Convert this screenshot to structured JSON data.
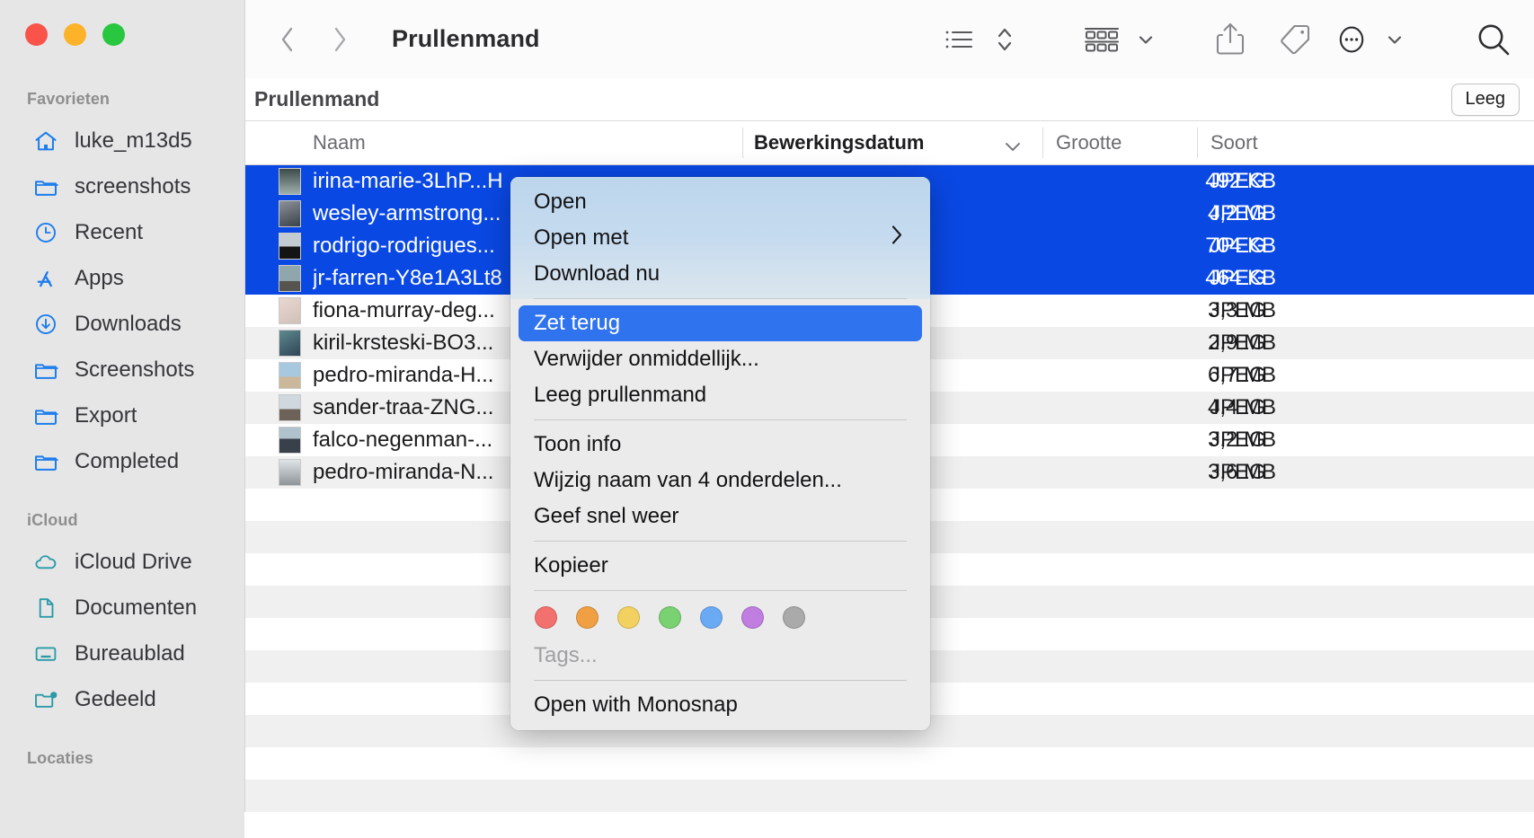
{
  "window": {
    "title": "Prullenmand",
    "traffic_lights": [
      "close-red",
      "minimize-yellow",
      "zoom-green"
    ]
  },
  "toolbar": {
    "back_icon": "chevron-left-icon",
    "forward_icon": "chevron-right-icon",
    "view_list_icon": "list-view-icon",
    "view_sort_icon": "sort-chevrons-icon",
    "group_icon": "group-by-icon",
    "group_chevron_icon": "chevron-down-icon",
    "share_icon": "share-icon",
    "tag_icon": "tag-icon",
    "more_icon": "ellipsis-circle-icon",
    "more_chevron_icon": "chevron-down-icon",
    "search_icon": "search-icon"
  },
  "pathbar": {
    "label": "Prullenmand",
    "empty_button": "Leeg"
  },
  "columns": {
    "name": "Naam",
    "date_modified": "Bewerkingsdatum",
    "size": "Grootte",
    "kind": "Soort",
    "sort_chevron_icon": "chevron-down-icon"
  },
  "sidebar": {
    "groups": [
      {
        "title": "Favorieten",
        "items": [
          {
            "label": "luke_m13d5",
            "icon": "home-icon",
            "color": "#1c7ced"
          },
          {
            "label": "screenshots",
            "icon": "folder-icon",
            "color": "#1c7ced"
          },
          {
            "label": "Recent",
            "icon": "clock-icon",
            "color": "#1c7ced"
          },
          {
            "label": "Apps",
            "icon": "appstore-icon",
            "color": "#1c7ced"
          },
          {
            "label": "Downloads",
            "icon": "download-circle-icon",
            "color": "#1c7ced"
          },
          {
            "label": "Screenshots",
            "icon": "folder-icon",
            "color": "#1c7ced"
          },
          {
            "label": "Export",
            "icon": "folder-icon",
            "color": "#1c7ced"
          },
          {
            "label": "Completed",
            "icon": "folder-icon",
            "color": "#1c7ced"
          }
        ]
      },
      {
        "title": "iCloud",
        "items": [
          {
            "label": "iCloud Drive",
            "icon": "cloud-icon",
            "color": "#2a9aa8"
          },
          {
            "label": "Documenten",
            "icon": "document-icon",
            "color": "#2a9aa8"
          },
          {
            "label": "Bureaublad",
            "icon": "desktop-icon",
            "color": "#2a9aa8"
          },
          {
            "label": "Gedeeld",
            "icon": "shared-folder-icon",
            "color": "#2a9aa8"
          }
        ]
      },
      {
        "title": "Locaties",
        "items": []
      }
    ]
  },
  "files": [
    {
      "name": "irina-marie-3LhP...H",
      "size": "492 KB",
      "kind": "JPEG",
      "selected": true,
      "thumb": [
        "#3d4a4a",
        "#9fb0ac"
      ]
    },
    {
      "name": "wesley-armstrong...",
      "size": "4,2 MB",
      "kind": "JPEG",
      "selected": true,
      "thumb": [
        "#8d9299",
        "#39414a"
      ]
    },
    {
      "name": "rodrigo-rodrigues...",
      "size": "704 KB",
      "kind": "JPEG",
      "selected": true,
      "thumb": [
        "#c3cbd2",
        "#141414"
      ]
    },
    {
      "name": "jr-farren-Y8e1A3Lt8",
      "size": "464 KB",
      "kind": "JPEG",
      "selected": true,
      "thumb": [
        "#8fa6ad",
        "#55544f"
      ]
    },
    {
      "name": "fiona-murray-deg...",
      "size": "3,3 MB",
      "kind": "JPEG",
      "selected": false,
      "thumb": [
        "#e9d8d1",
        "#cfc0b7"
      ]
    },
    {
      "name": "kiril-krsteski-BO3...",
      "size": "2,9 MB",
      "kind": "JPEG",
      "selected": false,
      "thumb": [
        "#5f8a8f",
        "#2e4455"
      ]
    },
    {
      "name": "pedro-miranda-H...",
      "size": "6,7 MB",
      "kind": "JPEG",
      "selected": false,
      "thumb": [
        "#a8c8e0",
        "#cbb79a"
      ]
    },
    {
      "name": "sander-traa-ZNG...",
      "size": "4,4 MB",
      "kind": "JPEG",
      "selected": false,
      "thumb": [
        "#cfd8df",
        "#6c6257"
      ]
    },
    {
      "name": "falco-negenman-...",
      "size": "3,2 MB",
      "kind": "JPEG",
      "selected": false,
      "thumb": [
        "#b0c2cc",
        "#38404a"
      ]
    },
    {
      "name": "pedro-miranda-N...",
      "size": "3,6 MB",
      "kind": "JPEG",
      "selected": false,
      "thumb": [
        "#dfe4e7",
        "#8f9499"
      ]
    }
  ],
  "context_menu": {
    "groups": [
      {
        "tinted": true,
        "items": [
          {
            "label": "Open",
            "submenu": false,
            "highlight": false
          },
          {
            "label": "Open met",
            "submenu": true,
            "highlight": false
          },
          {
            "label": "Download nu",
            "submenu": false,
            "highlight": false
          }
        ]
      },
      {
        "tinted": false,
        "items": [
          {
            "label": "Zet terug",
            "submenu": false,
            "highlight": true
          },
          {
            "label": "Verwijder onmiddellijk...",
            "submenu": false,
            "highlight": false
          },
          {
            "label": "Leeg prullenmand",
            "submenu": false,
            "highlight": false
          }
        ]
      },
      {
        "tinted": false,
        "items": [
          {
            "label": "Toon info",
            "submenu": false,
            "highlight": false
          },
          {
            "label": "Wijzig naam van 4 onderdelen...",
            "submenu": false,
            "highlight": false
          },
          {
            "label": "Geef snel weer",
            "submenu": false,
            "highlight": false
          }
        ]
      },
      {
        "tinted": false,
        "items": [
          {
            "label": "Kopieer",
            "submenu": false,
            "highlight": false
          }
        ]
      }
    ],
    "tags": {
      "colors": [
        "#f2716e",
        "#f0a043",
        "#f3d160",
        "#79d172",
        "#6aaaf5",
        "#bf7ee0",
        "#aaaaaa"
      ],
      "label": "Tags..."
    },
    "bottom_items": [
      {
        "label": "Open with Monosnap"
      }
    ],
    "submenu_arrow_icon": "chevron-right-icon"
  }
}
